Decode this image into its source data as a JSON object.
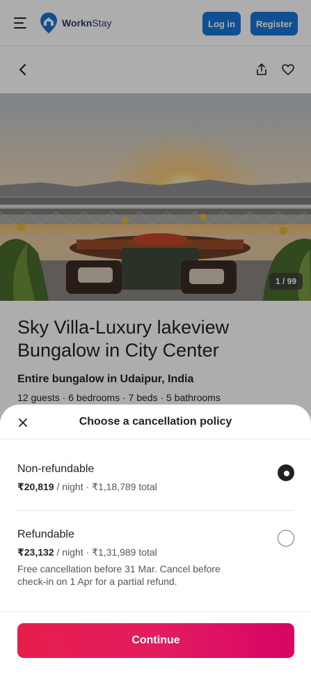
{
  "header": {
    "brand_bold": "Workn",
    "brand_light": "Stay",
    "login_label": "Log in",
    "register_label": "Register",
    "accent": "#1877d6"
  },
  "photo": {
    "counter": "1 / 99"
  },
  "listing": {
    "title": "Sky Villa-Luxury lakeview Bungalow in City Center",
    "subtitle": "Entire bungalow in Udaipur, India",
    "meta": "12 guests · 6 bedrooms · 7 beds · 5 bathrooms"
  },
  "sheet": {
    "title": "Choose a cancellation policy",
    "options": [
      {
        "name": "Non-refundable",
        "price": "₹20,819",
        "price_rest": " / night · ₹1,18,789 total",
        "note": "",
        "selected": true
      },
      {
        "name": "Refundable",
        "price": "₹23,132",
        "price_rest": " / night · ₹1,31,989 total",
        "note": "Free cancellation before 31 Mar. Cancel before check-in on 1 Apr for a partial refund.",
        "selected": false
      }
    ],
    "continue_label": "Continue",
    "continue_color": "#e31c5f"
  },
  "icons": [
    "menu-icon",
    "logo-icon",
    "chevron-left-icon",
    "share-icon",
    "heart-icon",
    "close-icon"
  ]
}
